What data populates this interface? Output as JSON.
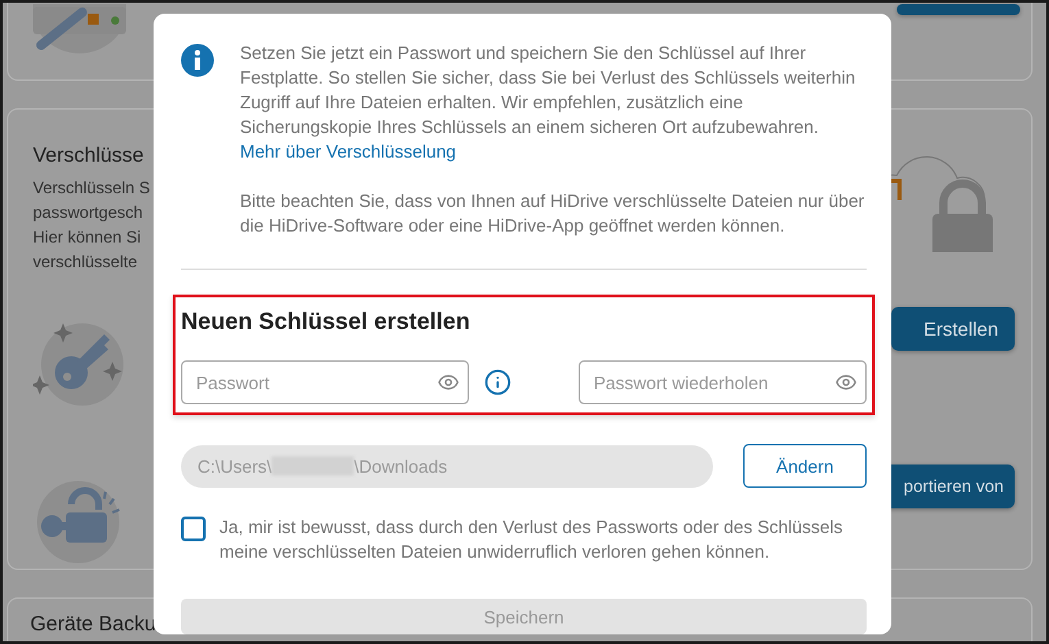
{
  "background": {
    "encryption_card": {
      "title": "Verschlüsse",
      "description_lines": [
        "Verschlüsseln S",
        "passwortgesch",
        "Hier können Si",
        "verschlüsselte"
      ],
      "buttons": [
        {
          "label": "Erstellen"
        },
        {
          "label": "portieren von"
        }
      ]
    },
    "backup_card": {
      "title": "Geräte Backu"
    }
  },
  "modal": {
    "info_text": "Setzen Sie jetzt ein Passwort und speichern Sie den Schlüssel auf Ihrer Festplatte. So stellen Sie sicher, dass Sie bei Verlust des Schlüssels weiterhin Zugriff auf Ihre Dateien erhalten. Wir empfehlen, zusätzlich eine Sicherungskopie Ihres Schlüssels an einem sicheren Ort aufzubewahren.",
    "link": "Mehr über Verschlüsselung",
    "note": "Bitte beachten Sie, dass von Ihnen auf HiDrive verschlüsselte Dateien nur über die HiDrive-Software oder eine HiDrive-App geöffnet werden können.",
    "section_title": "Neuen Schlüssel erstellen",
    "password": {
      "placeholder": "Passwort"
    },
    "password_repeat": {
      "placeholder": "Passwort wiederholen"
    },
    "path": {
      "start": "C:\\Users\\",
      "end": "\\Downloads"
    },
    "change_button": "Ändern",
    "consent": {
      "text": "Ja, mir ist bewusst, dass durch den Verlust des Passworts oder des Schlüssels meine verschlüsselten Dateien unwiderruflich verloren gehen können.",
      "checked": false
    },
    "save_button": {
      "label": "Speichern",
      "disabled": true
    }
  }
}
